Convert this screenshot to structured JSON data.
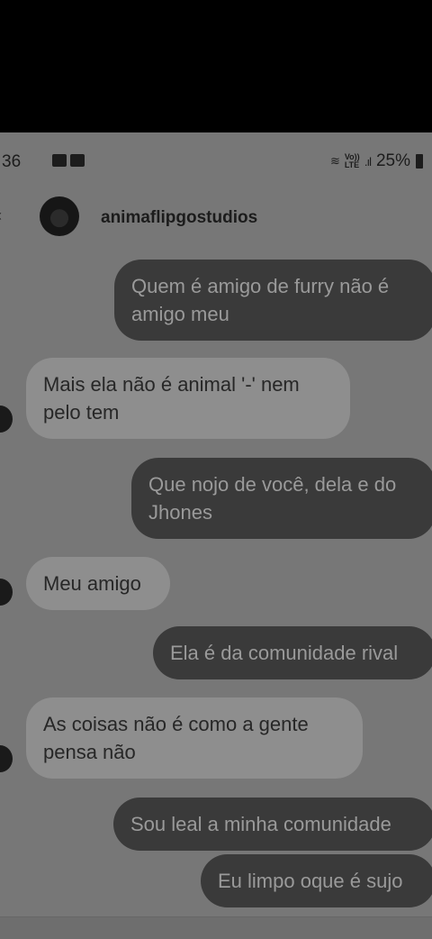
{
  "status_bar": {
    "time": "36",
    "network": "Vo)) LTE",
    "signal": ".ıl",
    "battery": "25%"
  },
  "header": {
    "username": "animaflipgostudios"
  },
  "messages": [
    {
      "side": "sent",
      "text": "Quem é amigo de furry não é amigo meu"
    },
    {
      "side": "received",
      "text": "Mais ela não é animal '-' nem pelo tem"
    },
    {
      "side": "sent",
      "text": "Que nojo de você, dela e do Jhones"
    },
    {
      "side": "received",
      "text": "Meu amigo"
    },
    {
      "side": "sent",
      "text": "Ela é da comunidade rival"
    },
    {
      "side": "received",
      "text": "As coisas não é como a gente pensa não"
    },
    {
      "side": "sent",
      "text": "Sou leal a minha comunidade"
    },
    {
      "side": "sent",
      "text": "Eu limpo oque é sujo"
    }
  ]
}
